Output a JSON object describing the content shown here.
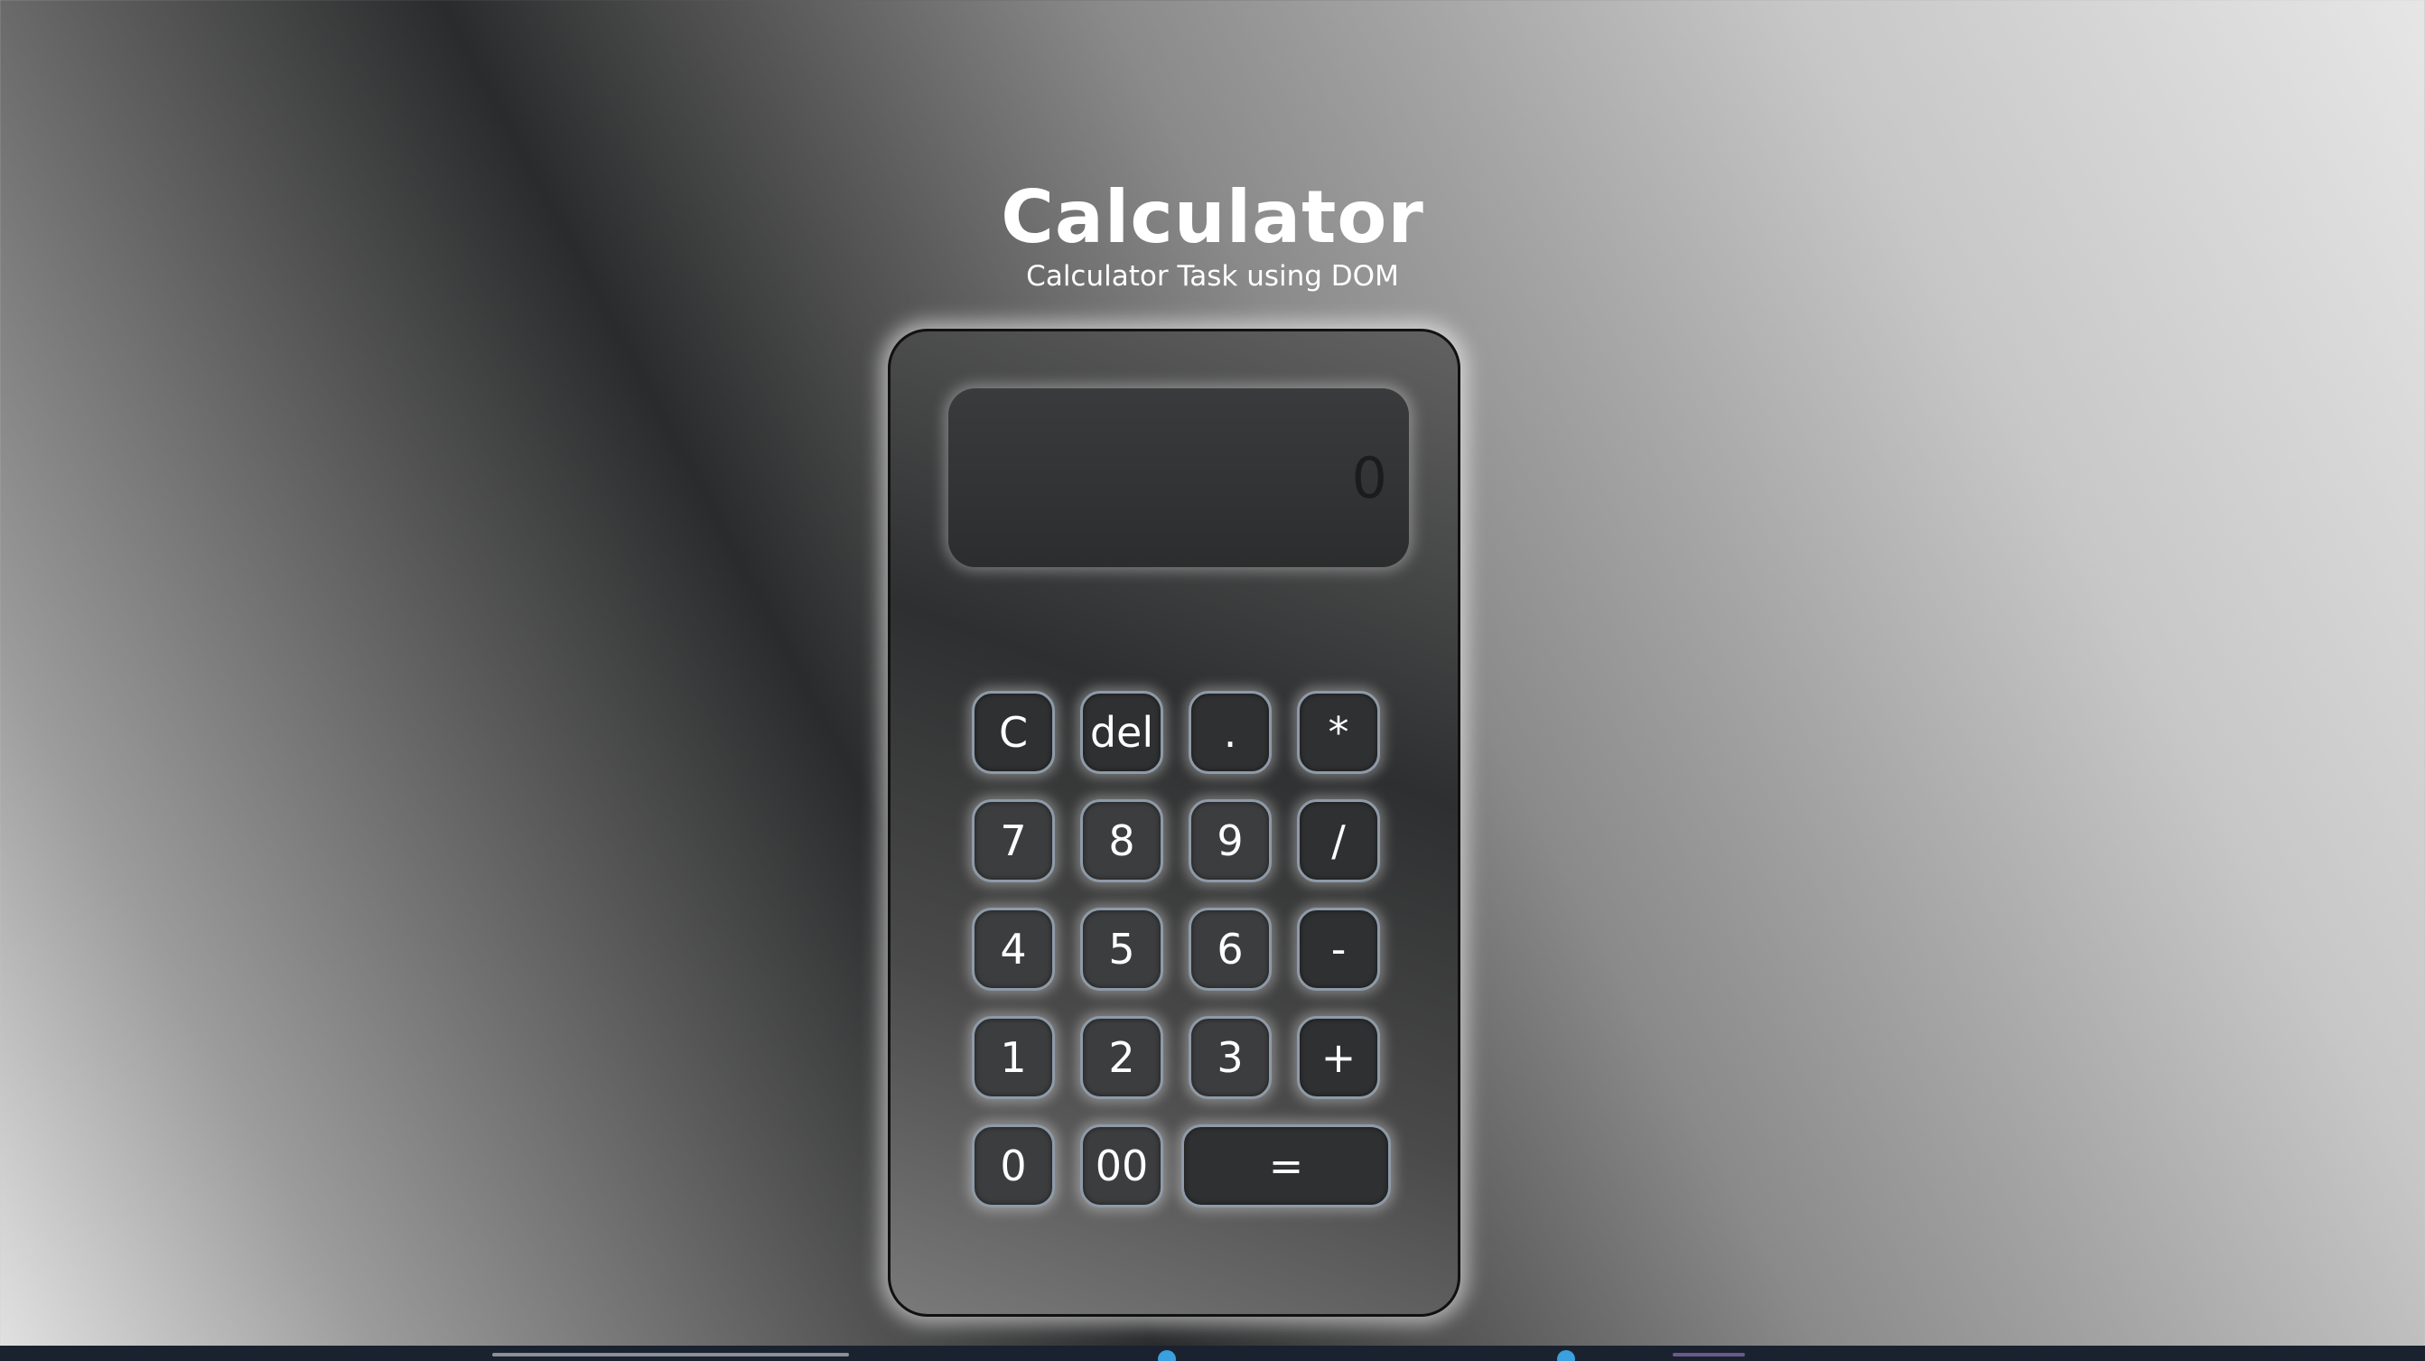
{
  "header": {
    "title": "Calculator",
    "subtitle": "Calculator Task using DOM"
  },
  "display": {
    "value": "0"
  },
  "keys": {
    "clear": "C",
    "del": "del",
    "dot": ".",
    "multiply": "*",
    "seven": "7",
    "eight": "8",
    "nine": "9",
    "divide": "/",
    "four": "4",
    "five": "5",
    "six": "6",
    "minus": "-",
    "one": "1",
    "two": "2",
    "three": "3",
    "plus": "+",
    "zero": "0",
    "double_zero": "00",
    "equals": "="
  },
  "colors": {
    "key_border": "#8e9aa8",
    "key_fill": "#2f3031",
    "calculator_border": "#111111"
  }
}
